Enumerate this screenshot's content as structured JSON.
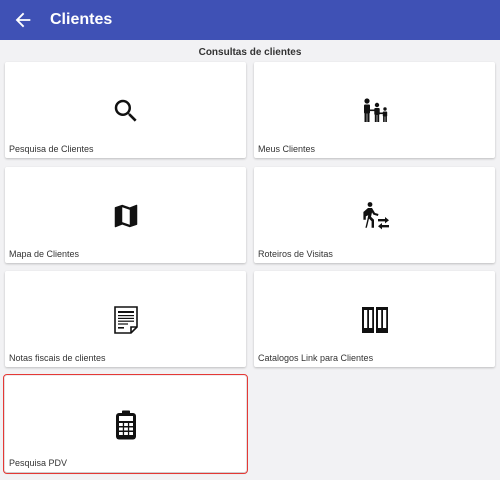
{
  "app_bar": {
    "title": "Clientes",
    "back_icon": "arrow-left-icon"
  },
  "section_title": "Consultas de clientes",
  "colors": {
    "primary": "#3f51b5",
    "selection": "#e53935"
  },
  "cards": [
    {
      "label": "Pesquisa de Clientes",
      "icon": "search-icon"
    },
    {
      "label": "Meus Clientes",
      "icon": "people-icon"
    },
    {
      "label": "Mapa de Clientes",
      "icon": "map-icon"
    },
    {
      "label": "Roteiros de Visitas",
      "icon": "walking-route-icon"
    },
    {
      "label": "Notas fiscais de clientes",
      "icon": "invoice-document-icon"
    },
    {
      "label": "Catalogos Link para Clientes",
      "icon": "catalog-book-icon"
    },
    {
      "label": "Pesquisa PDV",
      "icon": "calculator-icon"
    }
  ]
}
